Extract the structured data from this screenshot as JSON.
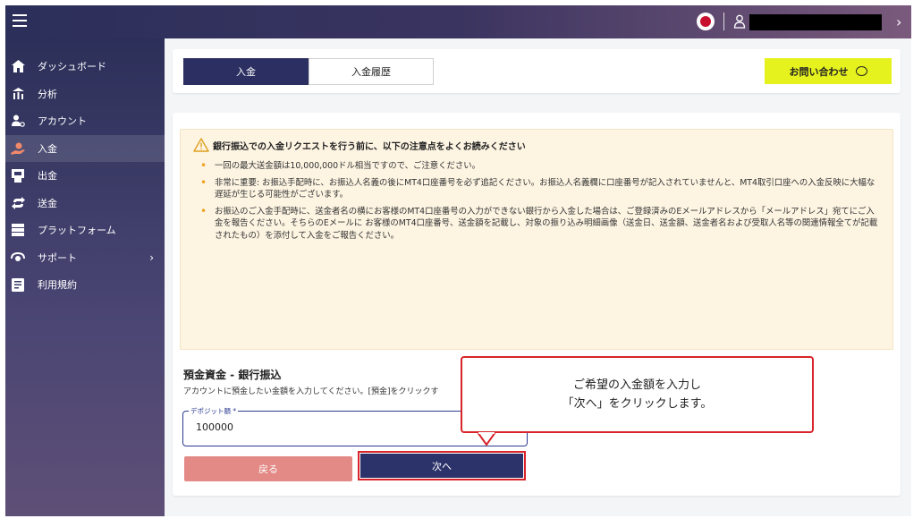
{
  "sidebar": {
    "items": [
      {
        "label": "ダッシュボード",
        "icon": "home-icon",
        "active": false
      },
      {
        "label": "分析",
        "icon": "analytics-icon",
        "active": false
      },
      {
        "label": "アカウント",
        "icon": "account-icon",
        "active": false
      },
      {
        "label": "入金",
        "icon": "deposit-icon",
        "active": true
      },
      {
        "label": "出金",
        "icon": "withdraw-icon",
        "active": false
      },
      {
        "label": "送金",
        "icon": "transfer-icon",
        "active": false
      },
      {
        "label": "プラットフォーム",
        "icon": "platform-icon",
        "active": false
      },
      {
        "label": "サポート",
        "icon": "support-icon",
        "active": false,
        "has_submenu": true
      },
      {
        "label": "利用規約",
        "icon": "terms-icon",
        "active": false
      }
    ]
  },
  "tabs": {
    "deposit": "入金",
    "history": "入金履歴"
  },
  "contact_button": "お問い合わせ",
  "notice": {
    "title": "銀行振込での入金リクエストを行う前に、以下の注意点をよくお読みください",
    "items": [
      "一回の最大送金額は10,000,000ドル相当ですので、ご注意ください。",
      "非常に重要: お振込手配時に、お振込人名義の後にMT4口座番号を必ず追記ください。お振込人名義欄に口座番号が記入されていませんと、MT4取引口座への入金反映に大幅な遅延が生じる可能性がございます。",
      "お振込のご入金手配時に、送金者名の横にお客様のMT4口座番号の入力ができない銀行から入金した場合は、ご登録済みのEメールアドレスから「メールアドレス」宛てにご入金を報告ください。そちらのEメールに お客様のMT4口座番号、送金額を記載し、対象の振り込み明細画像（送金日、送金額、送金者名および受取人名等の関連情報全てが記載されたもの）を添付して入金をご報告ください。"
    ]
  },
  "form": {
    "title": "預金資金 - 銀行振込",
    "description": "アカウントに預金したい金額を入力してください。[預金]をクリックす",
    "deposit_label": "デポジット額 *",
    "deposit_value": "100000",
    "back_button": "戻る",
    "next_button": "次へ"
  },
  "callout": {
    "line1": "ご希望の入金額を入力し",
    "line2": "「次へ」をクリックします。"
  },
  "colors": {
    "primary": "#2b2f62",
    "accent_yellow": "#e6f21e",
    "back_button": "#e38986",
    "highlight_red": "#d8242a",
    "notice_bg": "#fdf4e2"
  }
}
